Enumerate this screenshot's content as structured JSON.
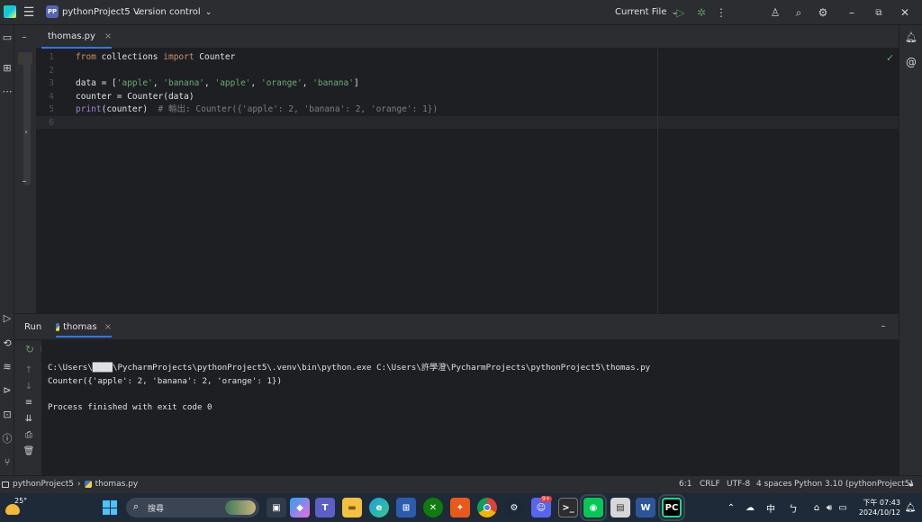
{
  "titlebar": {
    "project_badge": "PP",
    "project_name": "pythonProject5",
    "project_chevron": "⌄",
    "vcs_label": "Version control",
    "vcs_chevron": "⌄",
    "run_config": "Current File",
    "run_config_chevron": "⌄"
  },
  "editor_tab": {
    "label": "thomas.py",
    "close": "×"
  },
  "editor": {
    "lines": [
      {
        "num": "1",
        "tokens": [
          {
            "t": "from",
            "c": "kw"
          },
          {
            "t": " collections ",
            "c": ""
          },
          {
            "t": "import",
            "c": "kw"
          },
          {
            "t": " Counter",
            "c": ""
          }
        ]
      },
      {
        "num": "2",
        "tokens": []
      },
      {
        "num": "3",
        "tokens": [
          {
            "t": "data = [",
            "c": ""
          },
          {
            "t": "'apple'",
            "c": "str"
          },
          {
            "t": ", ",
            "c": ""
          },
          {
            "t": "'banana'",
            "c": "str"
          },
          {
            "t": ", ",
            "c": ""
          },
          {
            "t": "'apple'",
            "c": "str"
          },
          {
            "t": ", ",
            "c": ""
          },
          {
            "t": "'orange'",
            "c": "str"
          },
          {
            "t": ", ",
            "c": ""
          },
          {
            "t": "'banana'",
            "c": "str"
          },
          {
            "t": "]",
            "c": ""
          }
        ]
      },
      {
        "num": "4",
        "tokens": [
          {
            "t": "counter = Counter(data)",
            "c": ""
          }
        ]
      },
      {
        "num": "5",
        "tokens": [
          {
            "t": "print",
            "c": "fn"
          },
          {
            "t": "(counter)  ",
            "c": ""
          },
          {
            "t": "# 輸出: Counter({'apple': 2, 'banana': 2, 'orange': 1})",
            "c": "cm"
          }
        ]
      },
      {
        "num": "6",
        "tokens": []
      }
    ],
    "check_mark": "✓"
  },
  "run_panel": {
    "title": "Run",
    "tab_label": "thomas",
    "tab_close": "×",
    "output": [
      "C:\\Users\\████\\PycharmProjects\\pythonProject5\\.venv\\bin\\python.exe C:\\Users\\許學澄\\PycharmProjects\\pythonProject5\\thomas.py",
      "Counter({'apple': 2, 'banana': 2, 'orange': 1})",
      "",
      "Process finished with exit code 0"
    ]
  },
  "statusbar": {
    "breadcrumb_project": "pythonProject5",
    "breadcrumb_sep": "›",
    "breadcrumb_file": "thomas.py",
    "position": "6:1",
    "line_ending": "CRLF",
    "encoding": "UTF-8",
    "indent": "4 spaces",
    "interpreter": "Python 3.10 (pythonProject5)"
  },
  "taskbar": {
    "weather_temp": "25°",
    "search_placeholder": "搜尋",
    "tray_ime": "中",
    "time": "下午 07:43",
    "date": "2024/10/12",
    "discord_badge": "9+"
  },
  "colors": {
    "accent": "#3574f0",
    "bg": "#1e1f22",
    "panel": "#2b2d30"
  }
}
